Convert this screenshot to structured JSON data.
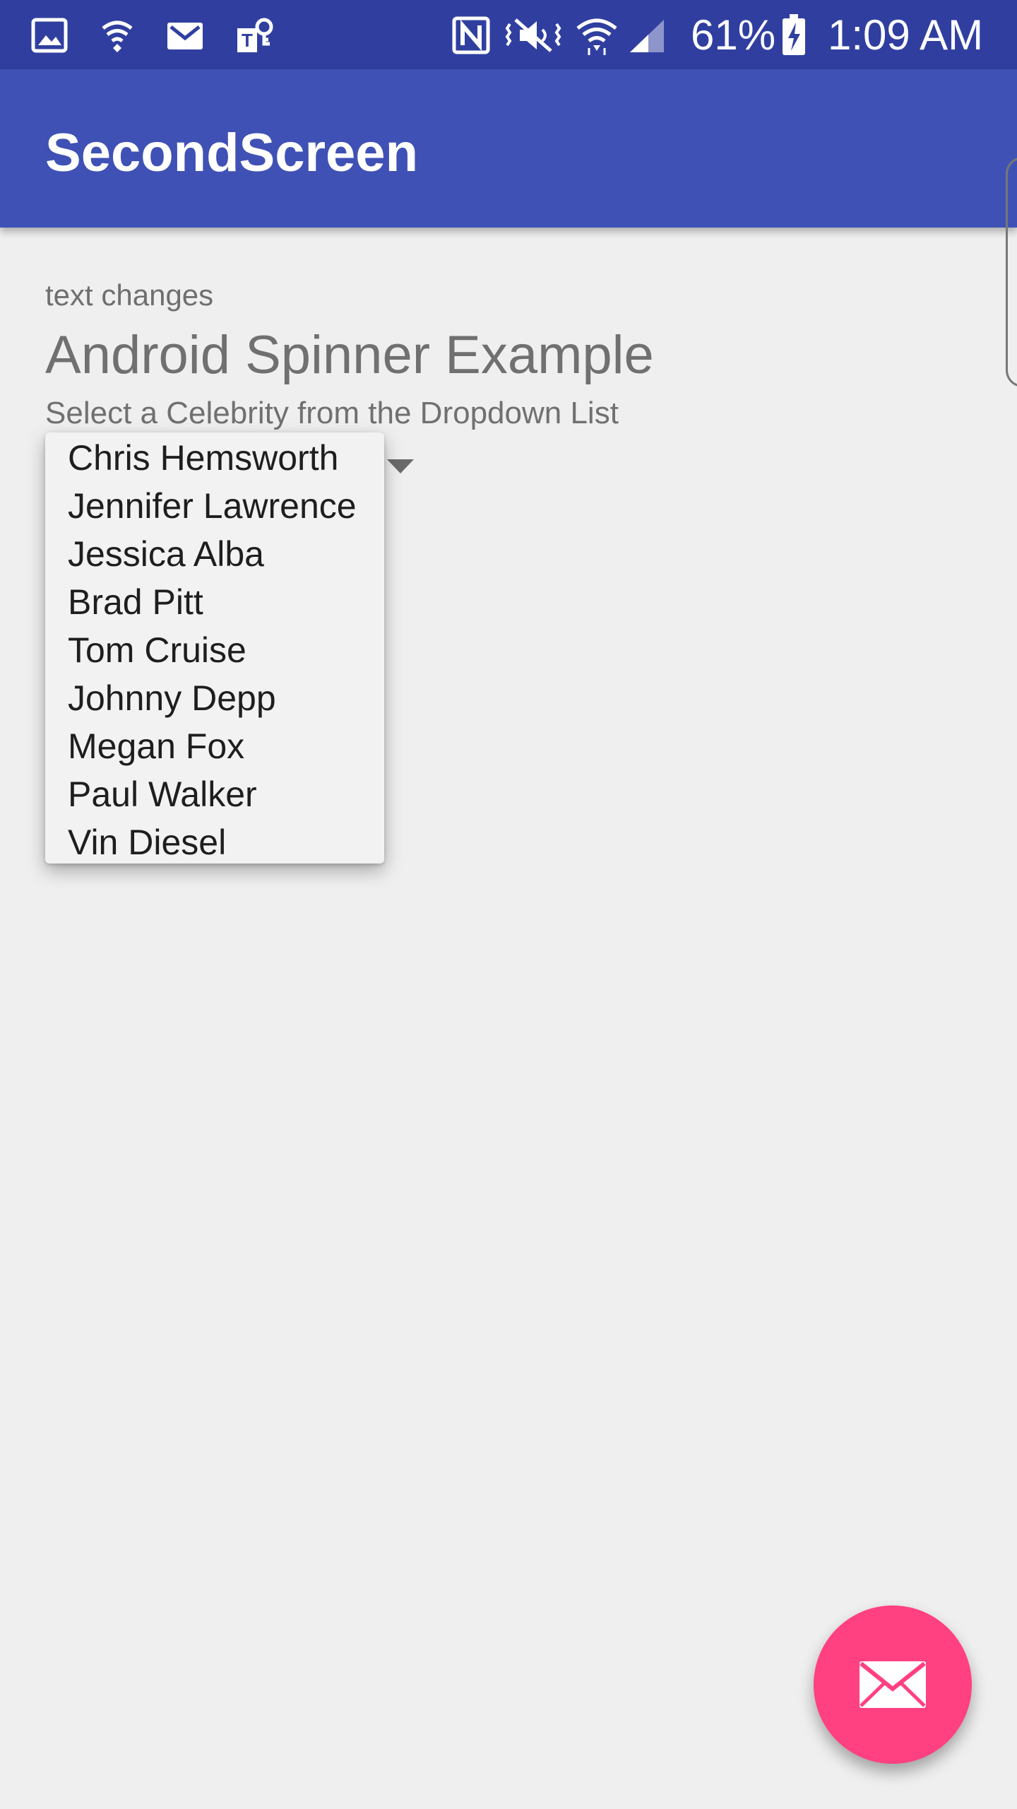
{
  "status_bar": {
    "battery_percent": "61%",
    "time": "1:09 AM",
    "icons": [
      "gallery-icon",
      "hotspot-icon",
      "gmail-icon",
      "t-mobile-app-icon",
      "nfc-icon",
      "vibrate-mute-icon",
      "wifi-icon",
      "signal-icon",
      "battery-charging-icon"
    ]
  },
  "app_bar": {
    "title": "SecondScreen"
  },
  "content": {
    "text_changes": "text changes",
    "heading": "Android Spinner Example",
    "subheading": "Select a Celebrity from the Dropdown List"
  },
  "spinner": {
    "options": [
      "Chris Hemsworth",
      "Jennifer Lawrence",
      "Jessica Alba",
      "Brad Pitt",
      "Tom Cruise",
      "Johnny Depp",
      "Megan Fox",
      "Paul Walker",
      "Vin Diesel"
    ]
  },
  "fab": {
    "icon": "email-icon"
  },
  "colors": {
    "status_bar": "#303f9f",
    "app_bar": "#3f51b5",
    "accent": "#ff4081",
    "background": "#efefef"
  }
}
